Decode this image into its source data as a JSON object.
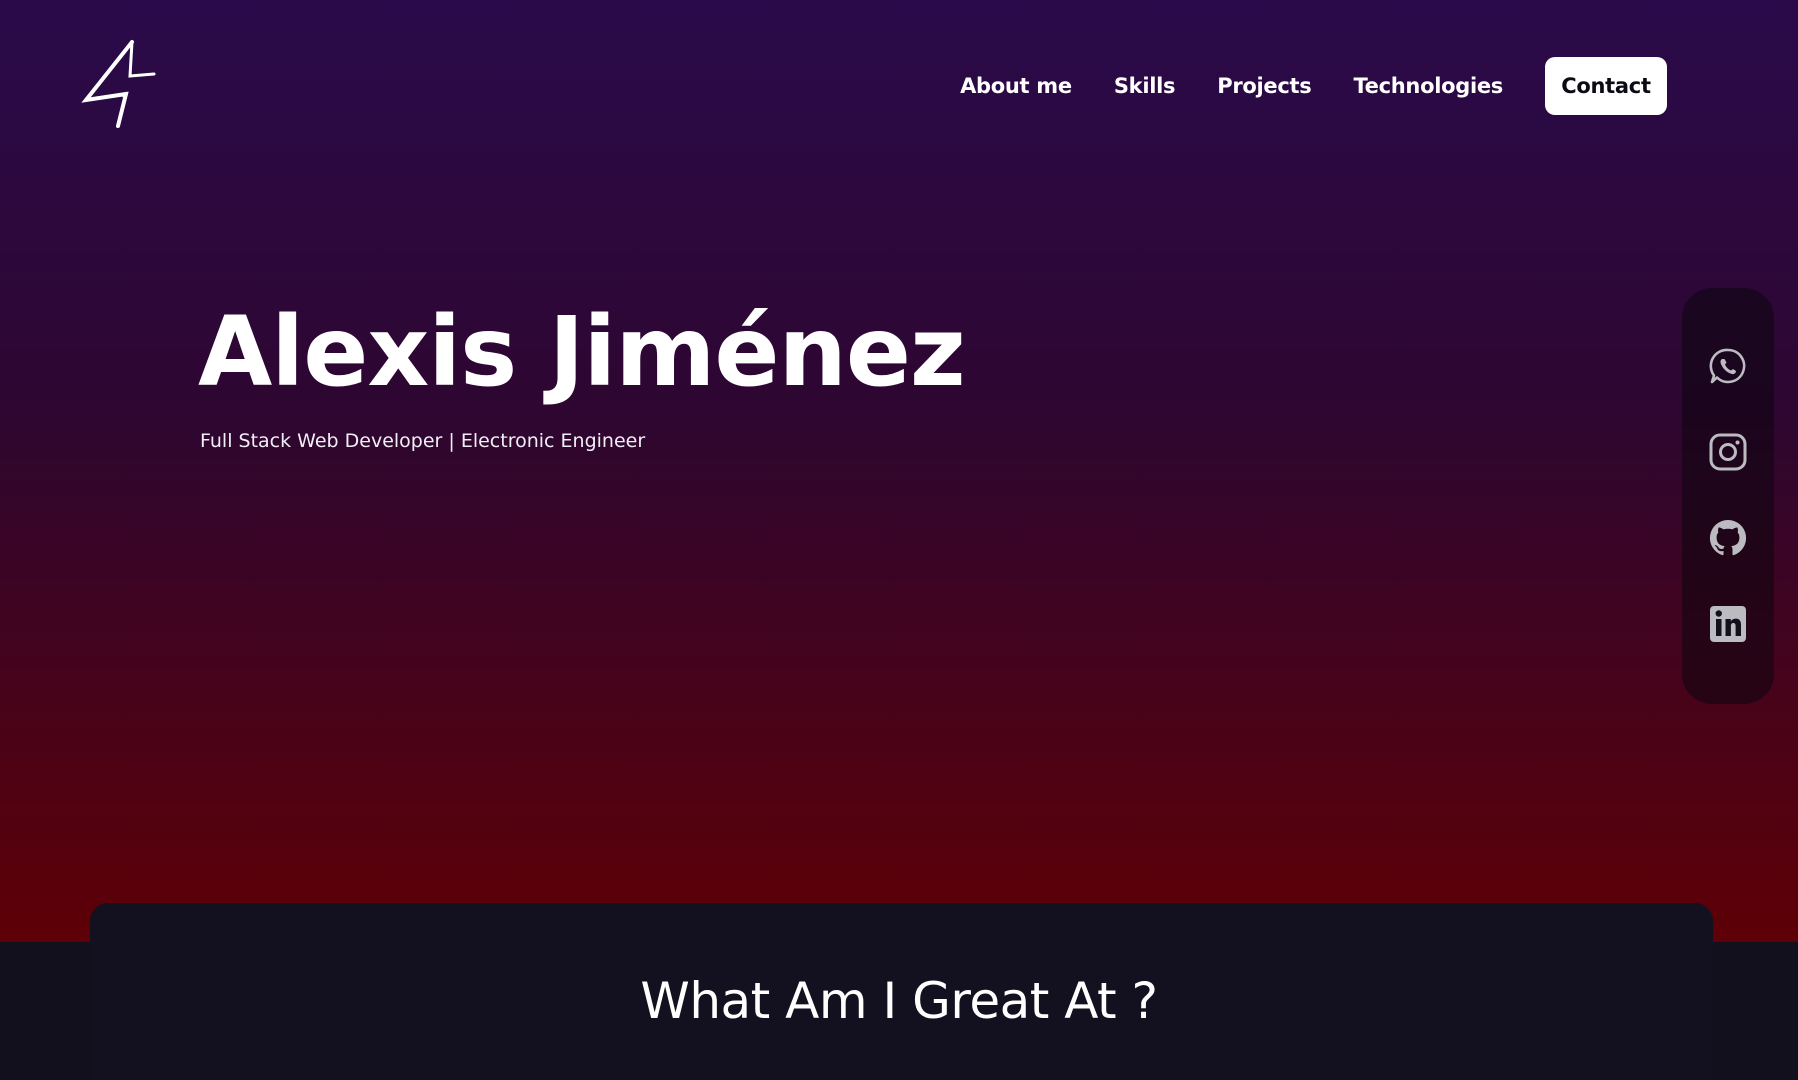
{
  "header": {
    "logo": "logo-icon",
    "nav": {
      "about": "About me",
      "skills": "Skills",
      "projects": "Projects",
      "technologies": "Technologies",
      "contact": "Contact"
    }
  },
  "hero": {
    "name": "Alexis Jiménez",
    "subtitle": "Full Stack Web Developer | Electronic Engineer"
  },
  "social": [
    {
      "name": "whatsapp-icon"
    },
    {
      "name": "instagram-icon"
    },
    {
      "name": "github-icon"
    },
    {
      "name": "linkedin-icon"
    }
  ],
  "skills_section": {
    "title": "What Am I Great At ?"
  },
  "colors": {
    "ring_top": "#2a0a4a",
    "ring_bottom": "#5e0006",
    "background": "#11101c",
    "card": "#13111f",
    "text": "#ffffff"
  }
}
